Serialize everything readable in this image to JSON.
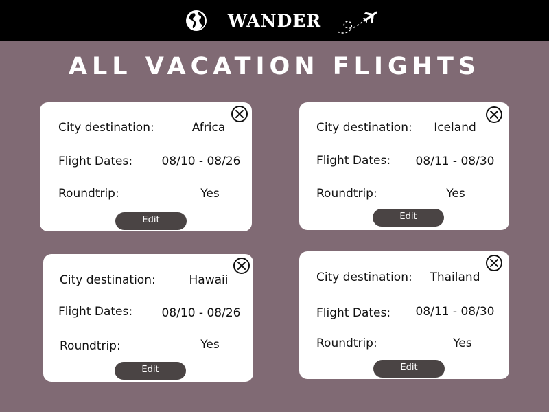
{
  "header": {
    "brand": "WANDER",
    "globe_icon": "globe-icon",
    "plane_icon": "airplane-dotted-trail-icon",
    "background": "#000000"
  },
  "page": {
    "title": "ALL VACATION FLIGHTS",
    "background": "#806a74"
  },
  "cards": [
    {
      "city_label": "City destination:",
      "city": "Africa",
      "dates_label": "Flight Dates:",
      "dates": "08/10 - 08/26",
      "roundtrip_label": "Roundtrip:",
      "roundtrip": "Yes",
      "edit_label": "Edit"
    },
    {
      "city_label": "City destination:",
      "city": "Iceland",
      "dates_label": "Flight Dates:",
      "dates": "08/11 - 08/30",
      "roundtrip_label": "Roundtrip:",
      "roundtrip": "Yes",
      "edit_label": "Edit"
    },
    {
      "city_label": "City destination:",
      "city": "Hawaii",
      "dates_label": "Flight Dates:",
      "dates": "08/10 - 08/26",
      "roundtrip_label": "Roundtrip:",
      "roundtrip": "Yes",
      "edit_label": "Edit"
    },
    {
      "city_label": "City destination:",
      "city": "Thailand",
      "dates_label": "Flight Dates:",
      "dates": "08/11 - 08/30",
      "roundtrip_label": "Roundtrip:",
      "roundtrip": "Yes",
      "edit_label": "Edit"
    }
  ]
}
